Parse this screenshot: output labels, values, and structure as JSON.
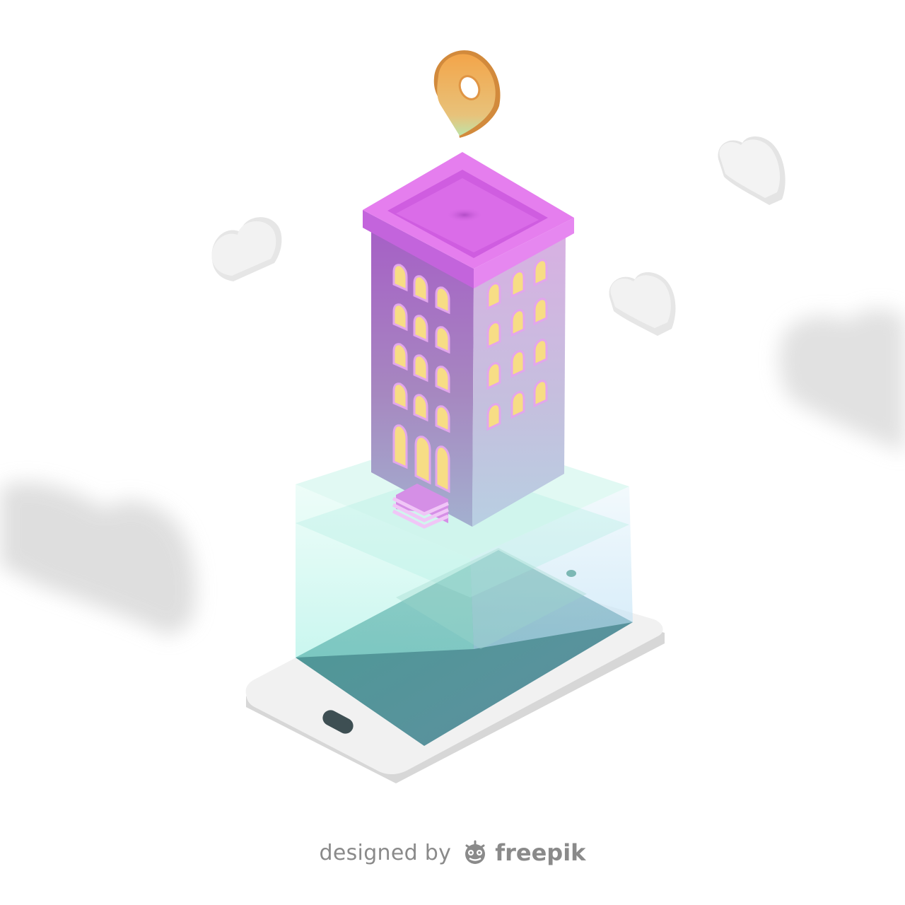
{
  "illustration": {
    "subject": "building-on-smartphone",
    "icons": [
      "location-pin-icon",
      "cloud-icon",
      "building-icon",
      "smartphone-icon"
    ],
    "colors": {
      "building_top": "#d96ae8",
      "building_left": "#b176c8",
      "building_right": "#cfa9dc",
      "window": "#f7dd85",
      "pin": "#f3a64a",
      "hologram": "#8de8d8",
      "screen": "#4f9d97",
      "phone_body": "#f1f1f1",
      "cloud": "#eaeaea",
      "credit_text": "#8a8a8a"
    }
  },
  "credit": {
    "prefix": "designed by",
    "brand": "freepik",
    "logo_icon": "freepik-logo-icon"
  }
}
